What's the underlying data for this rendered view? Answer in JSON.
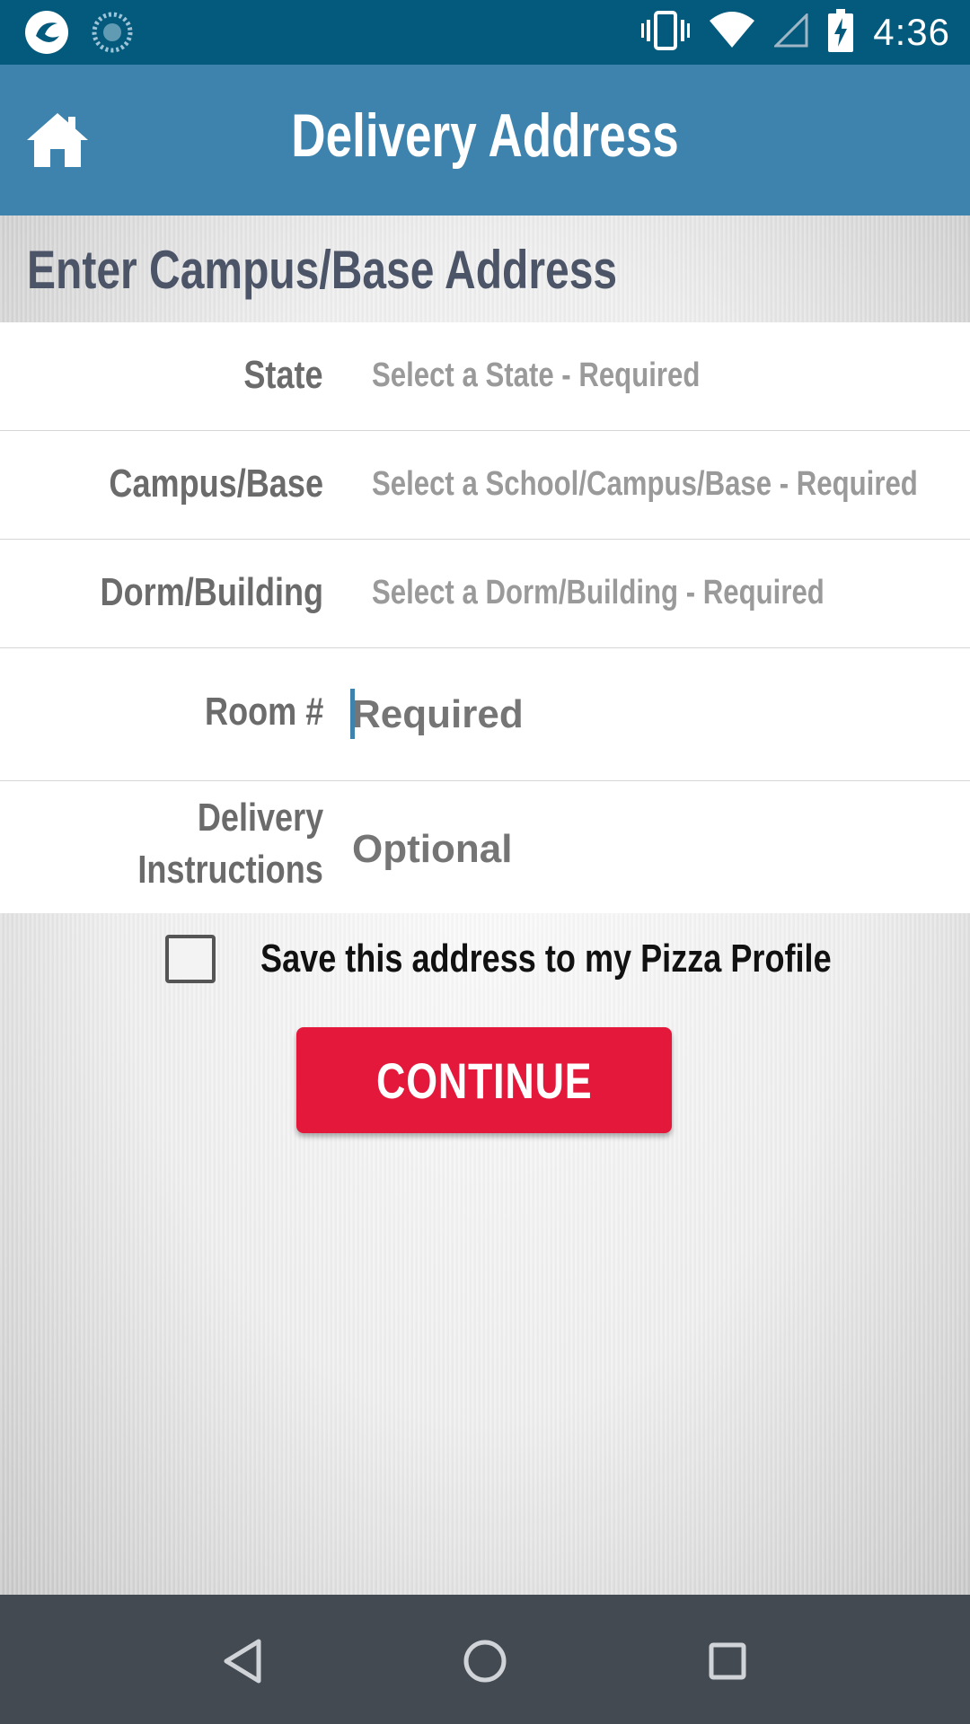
{
  "status_bar": {
    "time": "4:36",
    "icons": [
      "app-notification-icon",
      "sync-notification-icon",
      "vibrate-icon",
      "wifi-icon",
      "cellular-signal-icon",
      "battery-charging-icon"
    ]
  },
  "app_bar": {
    "title": "Delivery Address",
    "home_icon": "home-icon"
  },
  "section": {
    "title": "Enter Campus/Base Address"
  },
  "form": {
    "state": {
      "label": "State",
      "placeholder": "Select a State - Required"
    },
    "campus": {
      "label": "Campus/Base",
      "placeholder": "Select a School/Campus/Base - Required"
    },
    "dorm": {
      "label": "Dorm/Building",
      "placeholder": "Select a Dorm/Building - Required"
    },
    "room": {
      "label": "Room #",
      "placeholder": "Required",
      "value": ""
    },
    "instructions": {
      "label_line1": "Delivery",
      "label_line2": "Instructions",
      "placeholder": "Optional",
      "value": ""
    }
  },
  "save_profile": {
    "label": "Save this address to my Pizza Profile",
    "checked": false
  },
  "continue_button": {
    "label": "CONTINUE",
    "color": "#e3183a"
  },
  "colors": {
    "status_bar": "#045a7c",
    "app_bar": "#3d83ad",
    "section_title": "#4c5568",
    "nav_bar": "#434a52"
  },
  "nav": {
    "icons": [
      "back-icon",
      "home-circle-icon",
      "recents-icon"
    ]
  }
}
